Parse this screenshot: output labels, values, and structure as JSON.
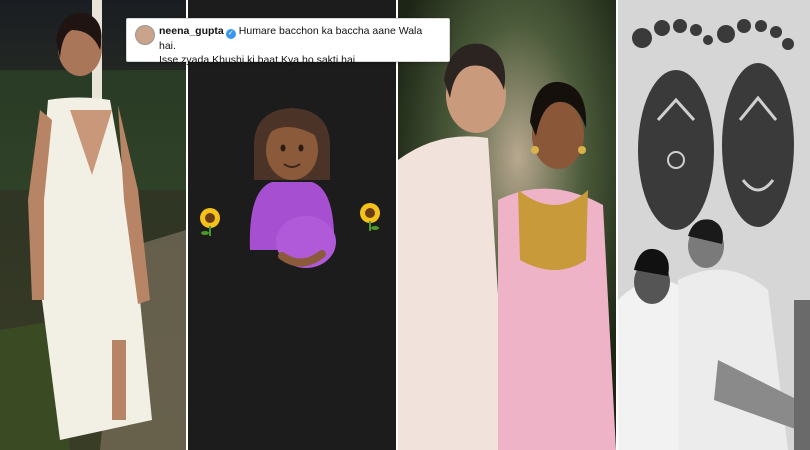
{
  "caption": {
    "username": "neena_gupta",
    "line1": "Humare bacchon ka baccha aane Wala hai.",
    "line2": "Isse zyada Khushi ki baat Kya ho sakti hai"
  },
  "colors": {
    "panel2_background": "#1c1c1c",
    "emoji_dress": "#a64fd1",
    "verified_badge": "#3897f0"
  },
  "emojis": {
    "center": "pregnant-woman",
    "left": "sunflower",
    "right": "sunflower"
  }
}
